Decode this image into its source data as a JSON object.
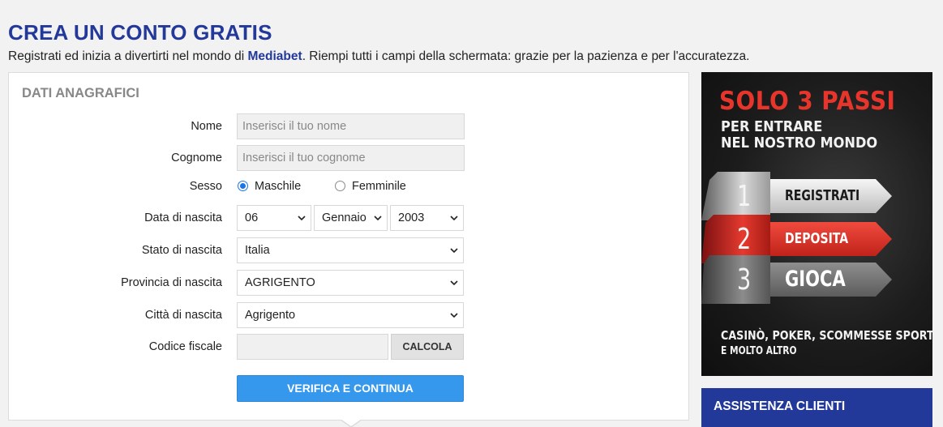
{
  "header": {
    "title": "CREA UN CONTO GRATIS",
    "subtitle_pre": "Registrati ed inizia a divertirti nel mondo di ",
    "subtitle_brand": "Mediabet",
    "subtitle_post": ". Riempi tutti i campi della schermata: grazie per la pazienza e per l'accuratezza."
  },
  "form": {
    "section_title": "DATI ANAGRAFICI",
    "nome": {
      "label": "Nome",
      "placeholder": "Inserisci il tuo nome"
    },
    "cognome": {
      "label": "Cognome",
      "placeholder": "Inserisci il tuo cognome"
    },
    "sesso": {
      "label": "Sesso",
      "options": [
        "Maschile",
        "Femminile"
      ],
      "selected": "Maschile"
    },
    "data_nascita": {
      "label": "Data di nascita",
      "day": "06",
      "month": "Gennaio",
      "year": "2003"
    },
    "stato_nascita": {
      "label": "Stato di nascita",
      "value": "Italia"
    },
    "provincia_nascita": {
      "label": "Provincia di nascita",
      "value": "AGRIGENTO"
    },
    "citta_nascita": {
      "label": "Città di nascita",
      "value": "Agrigento"
    },
    "codice_fiscale": {
      "label": "Codice fiscale",
      "value": "",
      "calc_label": "CALCOLA"
    },
    "submit_label": "VERIFICA E CONTINUA"
  },
  "promo": {
    "title": "SOLO 3 PASSI",
    "subtitle_line1": "PER ENTRARE",
    "subtitle_line2": "NEL NOSTRO MONDO",
    "steps": [
      {
        "number": "1",
        "label": "REGISTRATI"
      },
      {
        "number": "2",
        "label": "DEPOSITA"
      },
      {
        "number": "3",
        "label": "GIOCA"
      }
    ],
    "footer_line1": "CASINÒ, POKER, SCOMMESSE SPORTIVE",
    "footer_line2": "E MOLTO ALTRO"
  },
  "support": {
    "title": "ASSISTENZA CLIENTI"
  },
  "colors": {
    "brand_blue": "#23399a",
    "button_blue": "#3598ec",
    "promo_red": "#e8352b"
  }
}
